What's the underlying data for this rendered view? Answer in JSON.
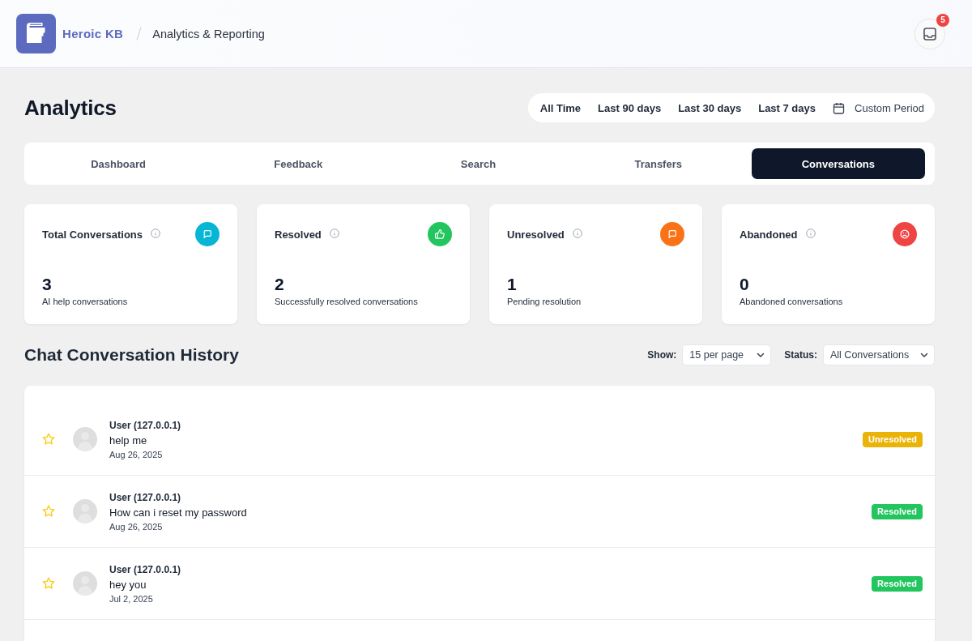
{
  "header": {
    "brand": "Heroic KB",
    "breadcrumb": "Analytics & Reporting",
    "notifications": {
      "count": "5"
    }
  },
  "page_title": "Analytics",
  "periods": [
    {
      "label": "All Time",
      "kind": "preset"
    },
    {
      "label": "Last 90 days",
      "kind": "preset"
    },
    {
      "label": "Last 30 days",
      "kind": "preset"
    },
    {
      "label": "Last 7 days",
      "kind": "preset"
    },
    {
      "label": "Custom Period",
      "kind": "custom"
    }
  ],
  "tabs": [
    {
      "label": "Dashboard",
      "selected": false
    },
    {
      "label": "Feedback",
      "selected": false
    },
    {
      "label": "Search",
      "selected": false
    },
    {
      "label": "Transfers",
      "selected": false
    },
    {
      "label": "Conversations",
      "selected": true
    }
  ],
  "stats": [
    {
      "title": "Total Conversations",
      "value": "3",
      "caption": "AI help conversations",
      "kind": "chat",
      "color": "#06b6d4"
    },
    {
      "title": "Resolved",
      "value": "2",
      "caption": "Successfully resolved conversations",
      "kind": "thumbs",
      "color": "#22c55e"
    },
    {
      "title": "Unresolved",
      "value": "1",
      "caption": "Pending resolution",
      "kind": "chat",
      "color": "#f97316"
    },
    {
      "title": "Abandoned",
      "value": "0",
      "caption": "Abandoned conversations",
      "kind": "frown",
      "color": "#ef4444"
    }
  ],
  "history": {
    "title": "Chat Conversation History",
    "show": {
      "label": "Show:",
      "value": "15 per page"
    },
    "status_filter": {
      "label": "Status:",
      "value": "All Conversations"
    }
  },
  "conversations": [
    {
      "starred": false,
      "user": "User (127.0.0.1)",
      "message": "help me",
      "date": "Aug 26, 2025",
      "status": {
        "label": "Unresolved",
        "color": "#eab308"
      }
    },
    {
      "starred": false,
      "user": "User (127.0.0.1)",
      "message": "How can i reset my password",
      "date": "Aug 26, 2025",
      "status": {
        "label": "Resolved",
        "color": "#22c55e"
      }
    },
    {
      "starred": false,
      "user": "User (127.0.0.1)",
      "message": "hey you",
      "date": "Jul 2, 2025",
      "status": {
        "label": "Resolved",
        "color": "#22c55e"
      }
    }
  ]
}
